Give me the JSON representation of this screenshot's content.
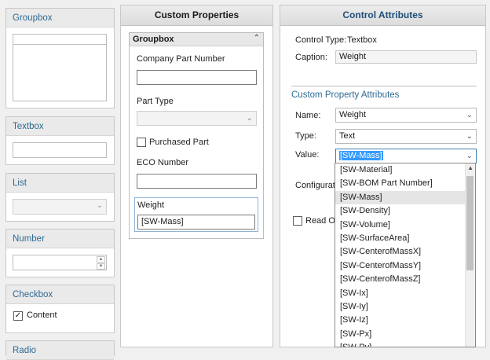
{
  "toolbox": {
    "groupbox": {
      "title": "Groupbox"
    },
    "textbox": {
      "title": "Textbox"
    },
    "list": {
      "title": "List"
    },
    "number": {
      "title": "Number"
    },
    "checkbox": {
      "title": "Checkbox",
      "item_label": "Content",
      "checked": true
    },
    "radio": {
      "title": "Radio"
    }
  },
  "custom_properties": {
    "header": "Custom Properties",
    "groupbox_title": "Groupbox",
    "fields": {
      "company_part_number": {
        "label": "Company Part Number",
        "value": ""
      },
      "part_type": {
        "label": "Part Type",
        "value": ""
      },
      "purchased_part": {
        "label": "Purchased Part",
        "checked": false
      },
      "eco_number": {
        "label": "ECO Number",
        "value": ""
      },
      "weight": {
        "label": "Weight",
        "value": "[SW-Mass]"
      }
    }
  },
  "control_attributes": {
    "header": "Control Attributes",
    "control_type_label": "Control Type:",
    "control_type_value": "Textbox",
    "caption_label": "Caption:",
    "caption_value": "Weight",
    "section_title": "Custom Property Attributes",
    "name_label": "Name:",
    "name_value": "Weight",
    "type_label": "Type:",
    "type_value": "Text",
    "value_label": "Value:",
    "value_value": "[SW-Mass]",
    "configurations_label": "Configuratio",
    "read_only_label": "Read On",
    "value_options": [
      "[SW-Material]",
      "[SW-BOM Part Number]",
      "[SW-Mass]",
      "[SW-Density]",
      "[SW-Volume]",
      "[SW-SurfaceArea]",
      "[SW-CenterofMassX]",
      "[SW-CenterofMassY]",
      "[SW-CenterofMassZ]",
      "[SW-Ix]",
      "[SW-Iy]",
      "[SW-Iz]",
      "[SW-Px]",
      "[SW-Py]"
    ],
    "selected_index": 2
  }
}
